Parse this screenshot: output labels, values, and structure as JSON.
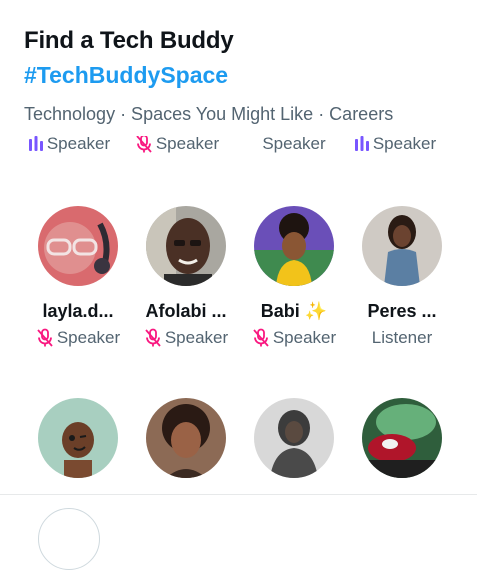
{
  "header": {
    "title": "Find a Tech Buddy",
    "hashtag": "#TechBuddySpace",
    "topics": "Technology · Spaces You Might Like · Careers"
  },
  "top_row": [
    {
      "role": "Speaker",
      "icon": "speaking-bars-icon"
    },
    {
      "role": "Speaker",
      "icon": "mic-muted-icon"
    },
    {
      "role": "Speaker",
      "icon": "none"
    },
    {
      "role": "Speaker",
      "icon": "speaking-bars-icon"
    }
  ],
  "participants_row1": [
    {
      "name": "layla.d...",
      "role": "Speaker",
      "icon": "mic-muted-icon",
      "emoji": ""
    },
    {
      "name": "Afolabi ...",
      "role": "Speaker",
      "icon": "mic-muted-icon",
      "emoji": ""
    },
    {
      "name": "Babi",
      "emoji": "✨",
      "role": "Speaker",
      "icon": "mic-muted-icon"
    },
    {
      "name": "Peres ...",
      "role": "Listener",
      "icon": "none",
      "emoji": ""
    }
  ],
  "colors": {
    "accent": "#1d9bf0",
    "muted_mic": "#f91880",
    "speaking_bars": "#7856ff",
    "secondary_text": "#536471"
  }
}
